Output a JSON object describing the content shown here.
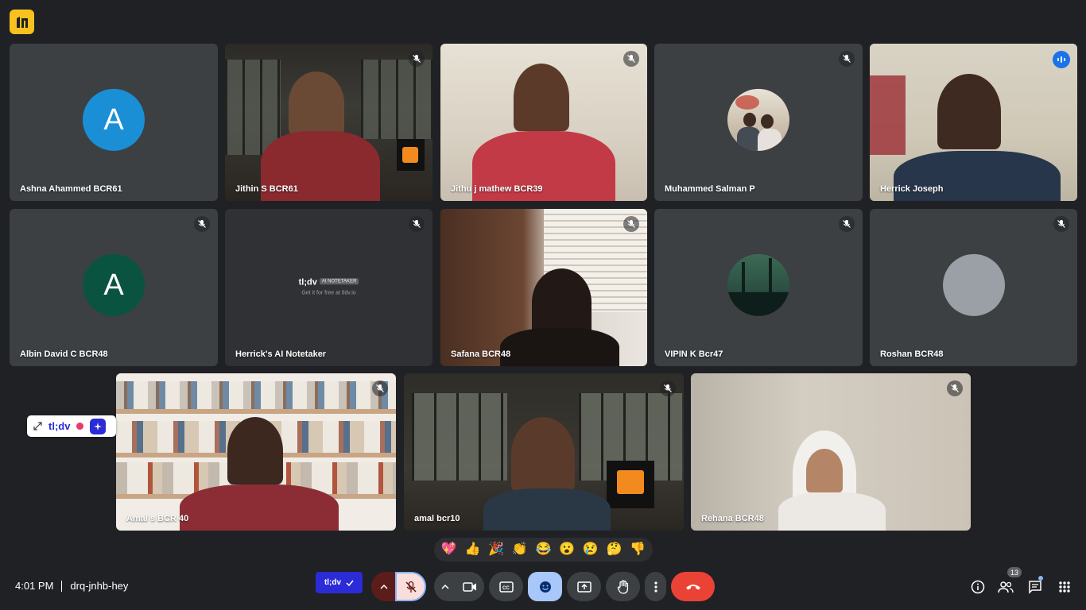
{
  "meeting": {
    "time": "4:01 PM",
    "code": "drq-jnhb-hey"
  },
  "participants": [
    {
      "name": "Ashna Ahammed BCR61",
      "avatar_letter": "A",
      "avatar_color": "#1a8fd6"
    },
    {
      "name": "Jithin S BCR61"
    },
    {
      "name": "Jithu j mathew BCR39"
    },
    {
      "name": "Muhammed Salman P"
    },
    {
      "name": "Herrick Joseph"
    },
    {
      "name": "Albin David C BCR48",
      "avatar_letter": "A",
      "avatar_color": "#0b5341"
    },
    {
      "name": "Herrick's AI Notetaker"
    },
    {
      "name": "Safana BCR48"
    },
    {
      "name": "VIPIN K Bcr47"
    },
    {
      "name": "Roshan BCR48"
    },
    {
      "name": "Amal s BCR 40"
    },
    {
      "name": "amal bcr10"
    },
    {
      "name": "Rehana BCR48"
    }
  ],
  "notetaker_card": {
    "brand": "tl;dv",
    "chip": "AI NOTETAKER",
    "sub": "Get it for free at tldv.io"
  },
  "tldv_float": {
    "label": "tl;dv"
  },
  "tldv_button": {
    "label": "tl;dv"
  },
  "reactions": [
    "💖",
    "👍",
    "🎉",
    "👏",
    "😂",
    "😮",
    "😢",
    "🤔",
    "👎"
  ],
  "people_count": "13",
  "colors": {
    "background": "#202124",
    "tile": "#3c4043",
    "end_call": "#ea4335",
    "mic_off": "#f9dedc",
    "emoji_active": "#a8c7fa",
    "speaking_outline": "#8ab4f8",
    "tldv_blue": "#2b2bd8"
  }
}
